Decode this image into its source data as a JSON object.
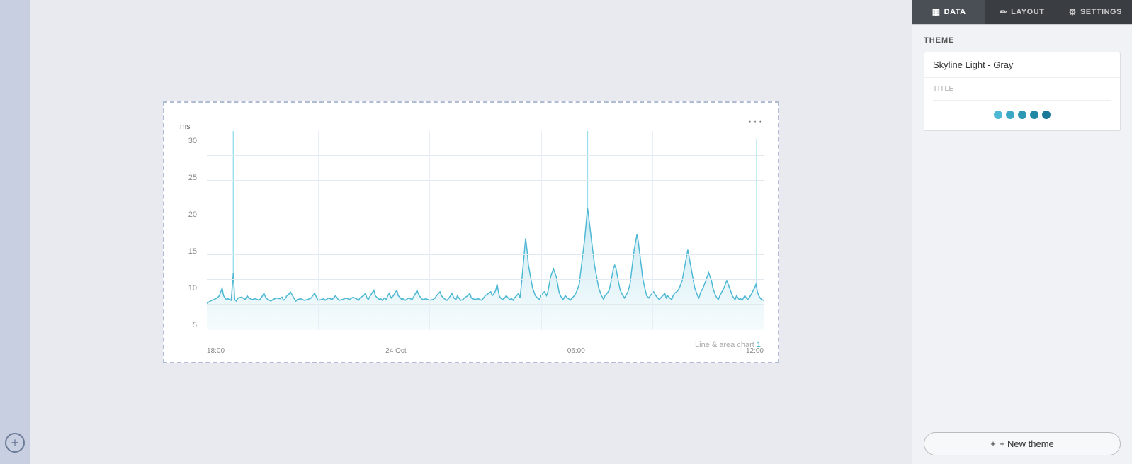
{
  "sidebar": {
    "add_icon": "+",
    "accent_color": "#4db8d4"
  },
  "panel": {
    "tabs": [
      {
        "id": "data",
        "label": "DATA",
        "icon": "▦",
        "active": true
      },
      {
        "id": "layout",
        "label": "LAYOUT",
        "icon": "✏"
      },
      {
        "id": "settings",
        "label": "SETTINGS",
        "icon": "⚙"
      }
    ],
    "theme_section_label": "THEME",
    "theme_name": "Skyline Light - Gray",
    "theme_preview_title": "TITLE",
    "preview_dots": [
      {
        "color": "#4db8d4"
      },
      {
        "color": "#3aa0bc"
      },
      {
        "color": "#2d8ca8"
      },
      {
        "color": "#2080a0"
      },
      {
        "color": "#1570908"
      }
    ],
    "new_theme_label": "+ New theme"
  },
  "chart": {
    "y_axis_labels": [
      "5",
      "10",
      "15",
      "20",
      "25",
      "30"
    ],
    "unit_label": "ms",
    "x_axis_labels": [
      "18:00",
      "24 Oct",
      "06:00",
      "12:00"
    ],
    "title": "Line & area chart",
    "title_number": "1",
    "more_btn": "···",
    "accent_color": "#4db8d4"
  }
}
